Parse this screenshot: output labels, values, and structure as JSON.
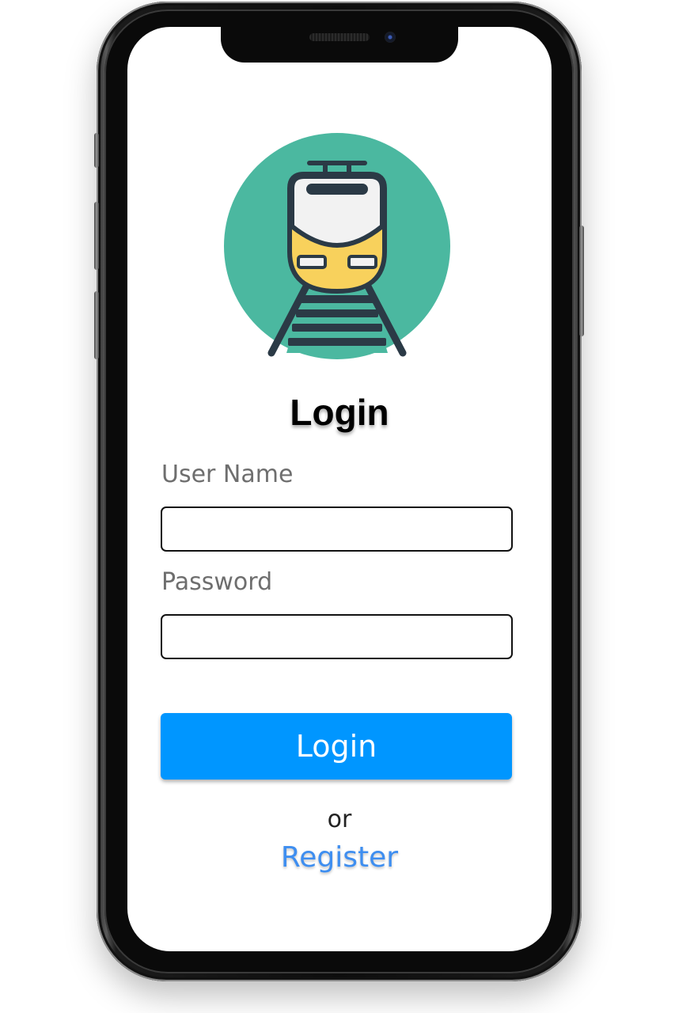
{
  "app": {
    "logo_icon": "train-on-tracks-icon",
    "logo_colors": {
      "circle": "#4bb8a0",
      "train_body": "#f8d15c",
      "train_window": "#f2f2f2",
      "outline": "#2b3a46"
    }
  },
  "login": {
    "title": "Login",
    "username_label": "User Name",
    "username_value": "",
    "password_label": "Password",
    "password_value": "",
    "submit_label": "Login",
    "or_text": "or",
    "register_link": "Register"
  },
  "colors": {
    "button": "#0096ff",
    "link": "#3e8ef0",
    "label": "#6e6e6e"
  }
}
